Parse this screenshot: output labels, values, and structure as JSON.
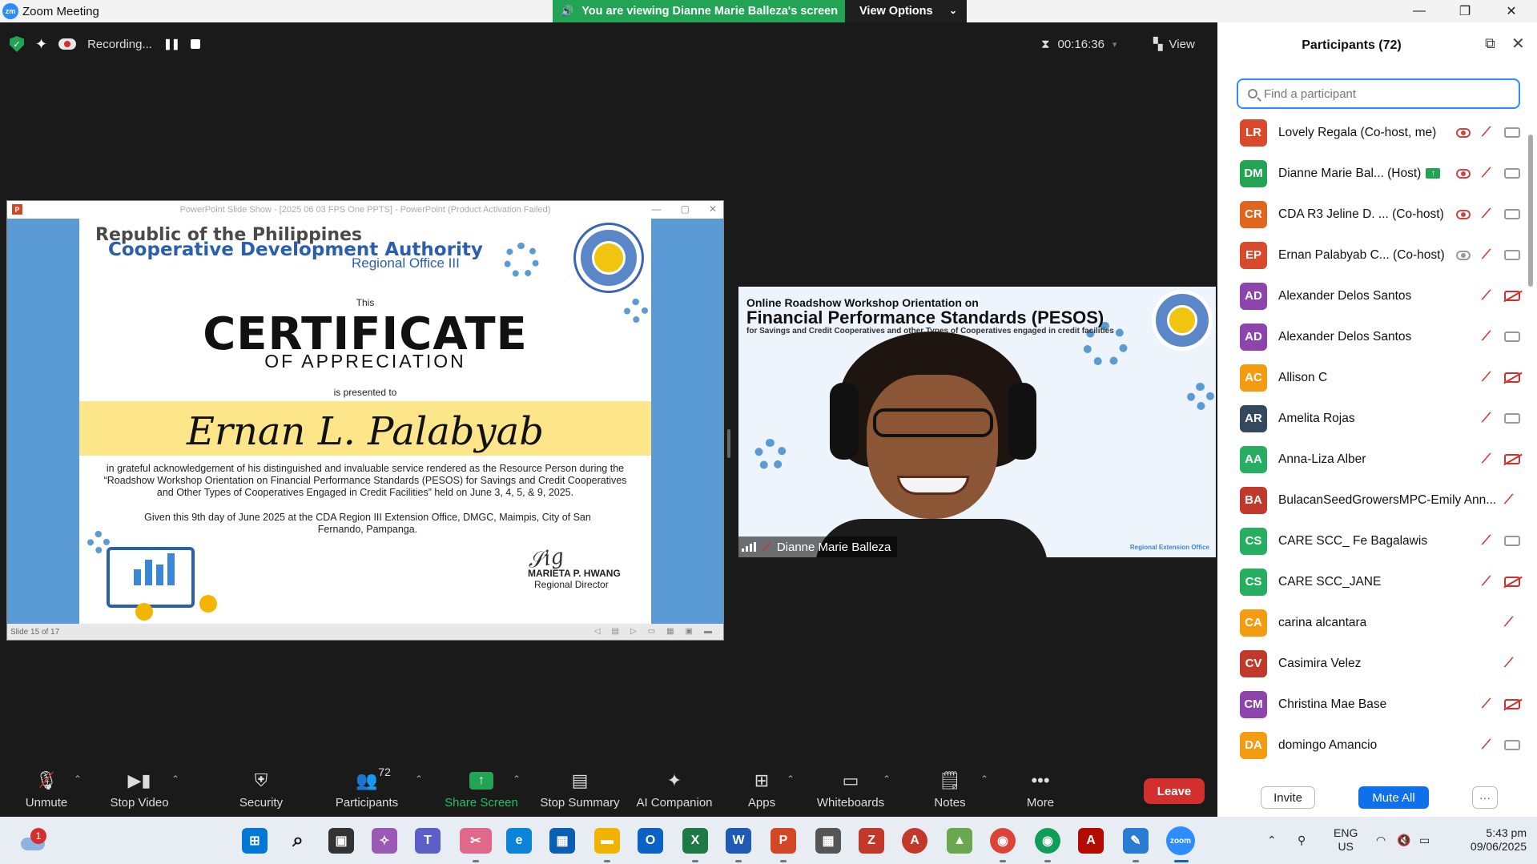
{
  "window": {
    "title": "Zoom Meeting",
    "app_icon_text": "zm",
    "minimize": "—",
    "restore": "❐",
    "close": "✕"
  },
  "share_banner": {
    "text": "You are viewing Dianne Marie Balleza's screen",
    "view_options": "View Options"
  },
  "meeting_bar": {
    "recording_label": "Recording...",
    "timer": "00:16:36",
    "view_label": "View"
  },
  "shared_screen": {
    "window_title": "PowerPoint Slide Show - [2025 06 03 FPS One PPTS] - PowerPoint (Product Activation Failed)",
    "status": "Slide 15 of 17",
    "slide": {
      "line1": "Republic of the Philippines",
      "line2": "Cooperative Development Authority",
      "line3": "Regional Office III",
      "this": "This",
      "certificate": "CERTIFICATE",
      "of_appreciation": "OF APPRECIATION",
      "presented": "is presented to",
      "recipient": "Ernan L. Palabyab",
      "body": "in grateful acknowledgement of his distinguished and invaluable service rendered as the Resource Person during the “Roadshow Workshop Orientation on Financial Performance Standards (PESOS) for Savings and Credit Cooperatives and Other Types of Cooperatives Engaged in Credit Facilities” held on June 3, 4, 5, & 9, 2025.",
      "given": "Given this 9th day of June 2025 at the CDA Region III Extension Office, DMGC, Maimpis, City of San Fernando, Pampanga.",
      "signatory": "MARIETA P. HWANG",
      "signatory_title": "Regional Director"
    }
  },
  "speaker_video": {
    "line1": "Online Roadshow Workshop Orientation on",
    "line2": "Financial Performance Standards (PESOS)",
    "line3": "for Savings and Credit Cooperatives and other Types of Cooperatives engaged in credit facilities",
    "footer": "Regional Extension Office",
    "name": "Dianne Marie Balleza"
  },
  "toolbar": {
    "unmute": "Unmute",
    "stop_video": "Stop Video",
    "security": "Security",
    "participants": "Participants",
    "participants_count": "72",
    "share_screen": "Share Screen",
    "stop_summary": "Stop Summary",
    "ai_companion": "AI Companion",
    "apps": "Apps",
    "whiteboards": "Whiteboards",
    "notes": "Notes",
    "more": "More",
    "leave": "Leave"
  },
  "participants_panel": {
    "title": "Participants (72)",
    "search_placeholder": "Find a participant",
    "invite": "Invite",
    "mute_all": "Mute All",
    "more": "···",
    "people": [
      {
        "initials": "LR",
        "name": "Lovely Regala",
        "role": "(Co-host, me)",
        "color": "#d84a2b",
        "rec": "red",
        "cam": "on"
      },
      {
        "initials": "DM",
        "name": "Dianne Marie Bal...",
        "role": "(Host)",
        "color": "#23a455",
        "rec": "red",
        "cam": "on",
        "sharing": true
      },
      {
        "initials": "CR",
        "name": "CDA R3 Jeline D. ...",
        "role": "(Co-host)",
        "color": "#e0661f",
        "rec": "red",
        "cam": "on"
      },
      {
        "initials": "EP",
        "name": "Ernan Palabyab C...",
        "role": "(Co-host)",
        "color": "#d84a2b",
        "rec": "grey",
        "cam": "on"
      },
      {
        "initials": "AD",
        "name": "Alexander Delos Santos",
        "role": "",
        "color": "#8e44ad",
        "cam": "off"
      },
      {
        "initials": "AD",
        "name": "Alexander Delos Santos",
        "role": "",
        "color": "#8e44ad",
        "cam": "on"
      },
      {
        "initials": "AC",
        "name": "Allison C",
        "role": "",
        "color": "#f39c12",
        "cam": "off"
      },
      {
        "initials": "AR",
        "name": "Amelita Rojas",
        "role": "",
        "color": "#34495e",
        "cam": "on"
      },
      {
        "initials": "AA",
        "name": "Anna-Liza Alber",
        "role": "",
        "color": "#27ae60",
        "cam": "off"
      },
      {
        "initials": "BA",
        "name": "BulacanSeedGrowersMPC-Emily Ann...",
        "role": "",
        "color": "#c0392b",
        "cam": "none"
      },
      {
        "initials": "CS",
        "name": "CARE SCC_ Fe Bagalawis",
        "role": "",
        "color": "#27ae60",
        "cam": "on"
      },
      {
        "initials": "CS",
        "name": "CARE SCC_JANE",
        "role": "",
        "color": "#27ae60",
        "cam": "off"
      },
      {
        "initials": "CA",
        "name": "carina alcantara",
        "role": "",
        "color": "#f39c12",
        "cam": "none"
      },
      {
        "initials": "CV",
        "name": "Casimira Velez",
        "role": "",
        "color": "#c0392b",
        "cam": "none"
      },
      {
        "initials": "CM",
        "name": "Christina Mae Base",
        "role": "",
        "color": "#8e44ad",
        "cam": "off"
      },
      {
        "initials": "DA",
        "name": "domingo Amancio",
        "role": "",
        "color": "#f39c12",
        "cam": "on"
      }
    ]
  },
  "taskbar": {
    "weather_badge": "1",
    "lang_line1": "ENG",
    "lang_line2": "US",
    "time": "5:43 pm",
    "date": "09/06/2025"
  },
  "accent": {
    "zoom_blue": "#2d8cff",
    "share_green": "#23a455",
    "leave_red": "#d32f2f"
  }
}
